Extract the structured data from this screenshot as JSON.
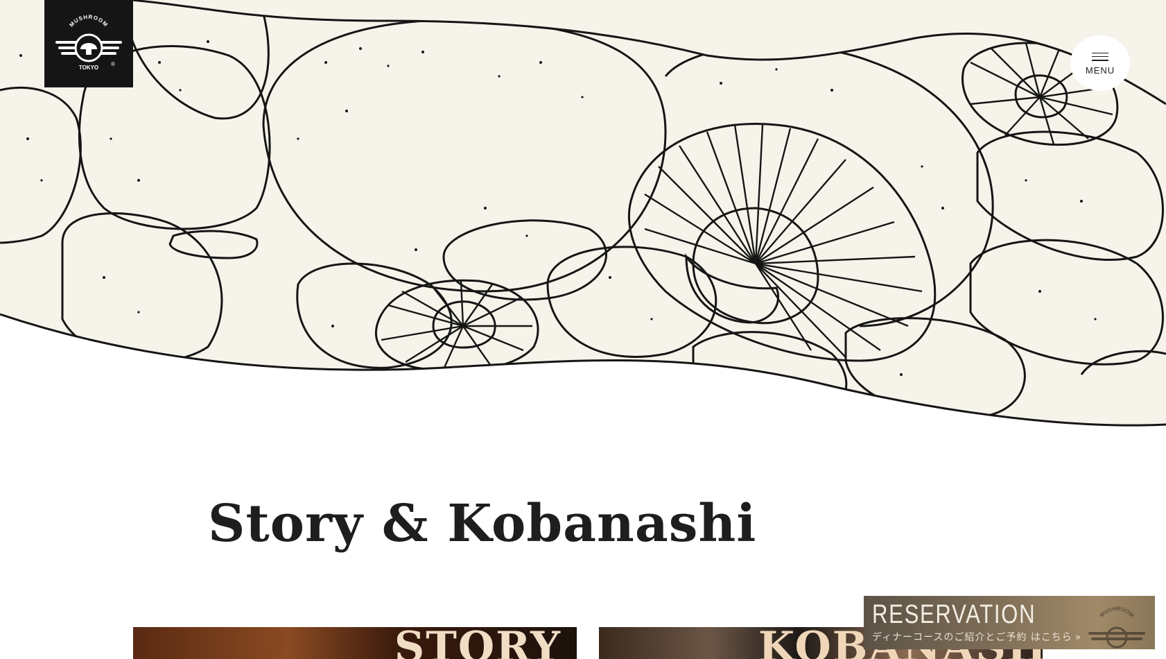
{
  "brand": {
    "name": "MUSHROOM",
    "city": "TOKYO",
    "mark": "®"
  },
  "menu": {
    "label": "MENU"
  },
  "section": {
    "title": "Story & Kobanashi"
  },
  "cards": [
    {
      "title": "STORY"
    },
    {
      "title": "KOBANASHI"
    }
  ],
  "reservation": {
    "title": "RESERVATION",
    "subtitle": "ディナーコースのご紹介とご予約 はこちら",
    "arrow": "»",
    "emblem_text": "MUSHROOM"
  },
  "colors": {
    "hero_background": "#f6f3ea",
    "ink": "#151515",
    "logo_background": "#151515",
    "reservation_gold": "#8a7658"
  },
  "icons": {
    "menu": "hamburger-icon",
    "logo": "mushroom-emblem-icon"
  }
}
